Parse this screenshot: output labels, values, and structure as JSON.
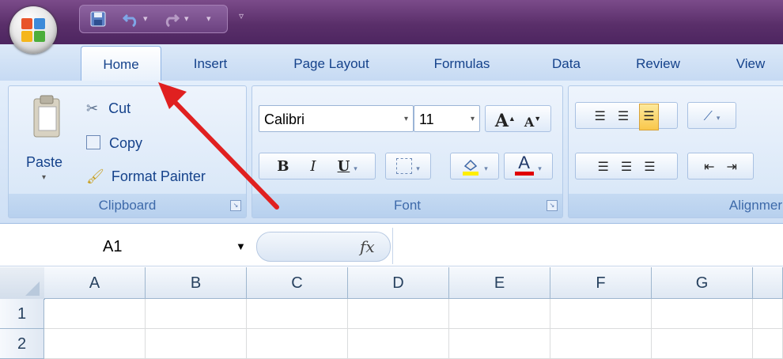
{
  "quick_access": {
    "items": [
      "save-icon",
      "undo-icon",
      "redo-icon",
      "customize-icon"
    ]
  },
  "tabs": [
    {
      "label": "Home",
      "active": true
    },
    {
      "label": "Insert"
    },
    {
      "label": "Page Layout"
    },
    {
      "label": "Formulas"
    },
    {
      "label": "Data"
    },
    {
      "label": "Review"
    },
    {
      "label": "View"
    }
  ],
  "clipboard": {
    "paste_label": "Paste",
    "cut_label": "Cut",
    "copy_label": "Copy",
    "format_painter_label": "Format Painter",
    "group_label": "Clipboard"
  },
  "font": {
    "font_name": "Calibri",
    "font_size": "11",
    "grow_label": "A",
    "shrink_label": "A",
    "bold_label": "B",
    "italic_label": "I",
    "underline_label": "U",
    "font_color_label": "A",
    "group_label": "Font"
  },
  "alignment": {
    "group_label": "Alignmer"
  },
  "formula_bar": {
    "name_box": "A1",
    "fx_label": "fx",
    "value": ""
  },
  "grid": {
    "columns": [
      "A",
      "B",
      "C",
      "D",
      "E",
      "F",
      "G"
    ],
    "rows": [
      "1",
      "2"
    ]
  },
  "colors": {
    "title_bar": "#5a2f6a",
    "ribbon": "#dce9f8",
    "annotation_arrow": "#e02020",
    "fill_swatch": "#ffee00",
    "font_color_swatch": "#e00000"
  }
}
